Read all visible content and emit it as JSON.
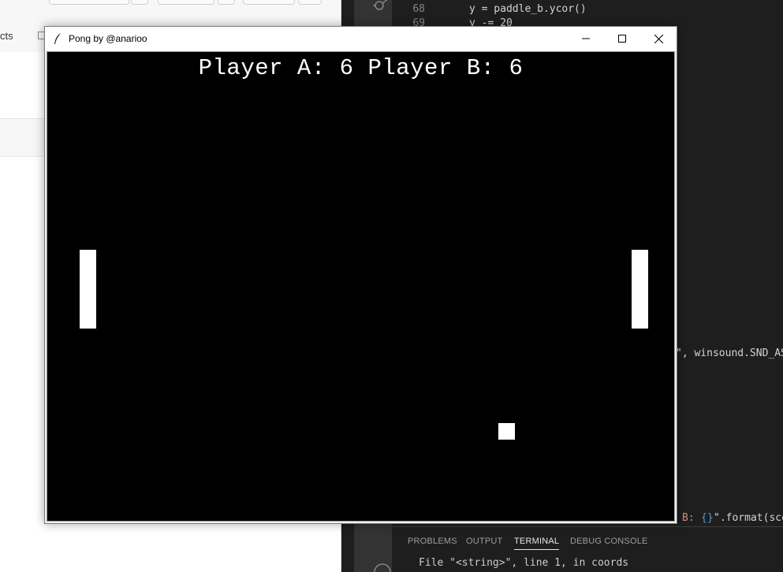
{
  "window": {
    "title": "Pong by @anarioo",
    "minimize_glyph": "—",
    "maximize_glyph": "☐",
    "close_glyph": "✕"
  },
  "game": {
    "score_text": "Player A: 6 Player B: 6",
    "score_a": 6,
    "score_b": 6,
    "background_color": "#000000",
    "foreground_color": "#ffffff"
  },
  "bg_browser": {
    "tab_text": "cts"
  },
  "editor": {
    "lines": [
      {
        "no": "68",
        "code": "y = paddle_b.ycor()"
      },
      {
        "no": "69",
        "code": "y -= 20"
      }
    ],
    "fragment_sound": "\", winsound.SND_AS",
    "fragment_format_b": "B: ",
    "fragment_format_braces": "{}",
    "fragment_format_rest": "\".format(sco"
  },
  "panel": {
    "tabs": [
      "PROBLEMS",
      "OUTPUT",
      "TERMINAL",
      "DEBUG CONSOLE"
    ],
    "active_tab": "TERMINAL",
    "terminal_line": "File \"<string>\", line 1, in coords"
  }
}
